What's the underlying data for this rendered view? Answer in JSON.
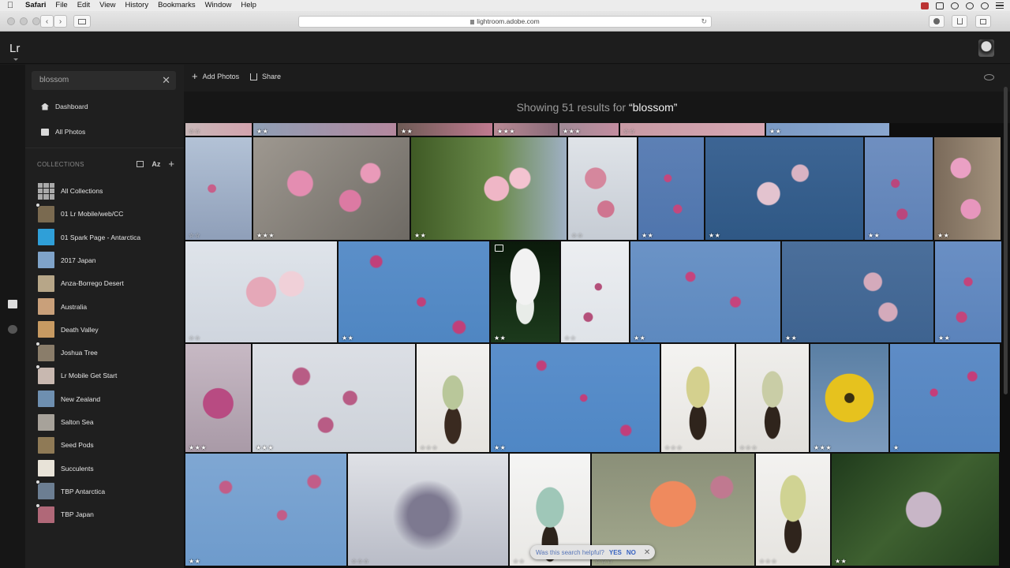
{
  "menubar": {
    "apple": "",
    "items": [
      "Safari",
      "File",
      "Edit",
      "View",
      "History",
      "Bookmarks",
      "Window",
      "Help"
    ]
  },
  "browser": {
    "url": "lightroom.adobe.com",
    "back": "‹",
    "forward": "›",
    "reload": "↻"
  },
  "app": {
    "logo": "Lr"
  },
  "sidebar": {
    "search_value": "blossom",
    "clear": "✕",
    "nav": [
      {
        "label": "Dashboard",
        "icon": "home-icon"
      },
      {
        "label": "All Photos",
        "icon": "photos-icon"
      }
    ],
    "collections_title": "COLLECTIONS",
    "sort_label": "Az",
    "add": "+",
    "collections": [
      {
        "label": "All Collections",
        "thumb": "grid"
      },
      {
        "label": "01 Lr Mobile/web/CC",
        "thumb": "#7a6a50",
        "synced": true
      },
      {
        "label": "01 Spark Page - Antarctica",
        "thumb": "#2f9fd8"
      },
      {
        "label": "2017 Japan",
        "thumb": "#7fa3c9"
      },
      {
        "label": "Anza-Borrego Desert",
        "thumb": "#b7a688"
      },
      {
        "label": "Australia",
        "thumb": "#c9a07a"
      },
      {
        "label": "Death Valley",
        "thumb": "#c79a62"
      },
      {
        "label": "Joshua Tree",
        "thumb": "#8a7d6a",
        "synced": true
      },
      {
        "label": "Lr Mobile Get Start",
        "thumb": "#c8b8b0",
        "synced": true
      },
      {
        "label": "New Zealand",
        "thumb": "#6e8fb0"
      },
      {
        "label": "Salton Sea",
        "thumb": "#a7a29a"
      },
      {
        "label": "Seed Pods",
        "thumb": "#8f7a56"
      },
      {
        "label": "Succulents",
        "thumb": "#e8e3d8"
      },
      {
        "label": "TBP Antarctica",
        "thumb": "#6c7e92",
        "synced": true
      },
      {
        "label": "TBP Japan",
        "thumb": "#b06878",
        "synced": true
      }
    ]
  },
  "toolbar": {
    "add_photos": "Add Photos",
    "share": "Share"
  },
  "results": {
    "prefix": "Showing 51 results for ",
    "query": "“blossom”"
  },
  "photos": [
    {
      "row": 0,
      "stars": "☆☆",
      "empty": true,
      "bg": "linear-gradient(90deg,#c8b7b8,#d3a3ae)"
    },
    {
      "row": 0,
      "stars": "★★",
      "empty": false,
      "bg": "linear-gradient(90deg,#8f9fb5,#b4889e)"
    },
    {
      "row": 0,
      "stars": "★★",
      "empty": false,
      "bg": "linear-gradient(90deg,#6e5b55,#c07a90)"
    },
    {
      "row": 0,
      "stars": "★★★",
      "empty": false,
      "bg": "linear-gradient(90deg,#b88a95,#8a6a78)"
    },
    {
      "row": 0,
      "stars": "★★★",
      "empty": false,
      "bg": "linear-gradient(90deg,#a08a96,#c38da0)"
    },
    {
      "row": 0,
      "stars": "☆☆",
      "empty": true,
      "bg": "linear-gradient(90deg,#c79aa4,#d7a7b3)"
    },
    {
      "row": 0,
      "stars": "★★",
      "empty": false,
      "bg": "linear-gradient(90deg,#7b9ac4,#8aa7cf)"
    },
    {
      "row": 1,
      "stars": "☆☆",
      "empty": true,
      "bg": "radial-gradient(circle at 40% 50%,#c85f8a 0 6%,transparent 7%),linear-gradient(#b3c2d6,#8f9fb9)"
    },
    {
      "row": 1,
      "stars": "★★★",
      "empty": false,
      "bg": "radial-gradient(circle at 30% 45%,#e48db1 0 10%,transparent 11%),radial-gradient(circle at 62% 62%,#dc7aa3 0 9%,transparent 10%),radial-gradient(circle at 75% 35%,#e99ab9 0 7%,transparent 8%),linear-gradient(135deg,#9e9890,#6e6a64)"
    },
    {
      "row": 1,
      "stars": "★★",
      "empty": false,
      "bg": "radial-gradient(circle at 55% 50%,#efb6c6 0 12%,transparent 13%),radial-gradient(circle at 70% 40%,#f3c3d0 0 8%,transparent 9%),linear-gradient(90deg,#3f5a25,#6a8a4a 55%,#9fb0c4)"
    },
    {
      "row": 1,
      "stars": "☆☆",
      "empty": true,
      "bg": "radial-gradient(circle at 40% 40%,#d5879d 0 14%,transparent 15%),radial-gradient(circle at 55% 70%,#cf7590 0 10%,transparent 11%),linear-gradient(#dfe3e8,#c6ccd4)"
    },
    {
      "row": 1,
      "stars": "★★",
      "empty": false,
      "bg": "radial-gradient(circle at 45% 40%,#c2487e 0 5%,transparent 6%),radial-gradient(circle at 60% 70%,#c2487e 0 5%,transparent 6%),linear-gradient(#5d80b5,#4f75ad)"
    },
    {
      "row": 1,
      "stars": "★★",
      "empty": false,
      "bg": "radial-gradient(circle at 40% 55%,#e3c3cf 0 10%,transparent 11%),radial-gradient(circle at 60% 35%,#d9b3c3 0 7%,transparent 8%),linear-gradient(#3d6594,#2f5885)"
    },
    {
      "row": 1,
      "stars": "★★",
      "empty": false,
      "bg": "radial-gradient(circle at 45% 45%,#b9477d 0 6%,transparent 7%),radial-gradient(circle at 55% 75%,#b9477d 0 6%,transparent 7%),linear-gradient(#6f8fc0,#5f82b7)"
    },
    {
      "row": 1,
      "stars": "★★",
      "empty": false,
      "bg": "radial-gradient(circle at 40% 30%,#eaa0c4 0 12%,transparent 13%),radial-gradient(circle at 55% 70%,#e796bd 0 12%,transparent 13%),linear-gradient(90deg,#7a6a5a,#a3927d)"
    },
    {
      "row": 2,
      "stars": "☆☆",
      "empty": true,
      "bg": "radial-gradient(circle at 50% 50%,#e5a8b8 0 16%,transparent 17%),radial-gradient(circle at 70% 42%,#f0d0d8 0 10%,transparent 11%),linear-gradient(#dfe4ea,#cfd5de)"
    },
    {
      "row": 2,
      "stars": "★★",
      "empty": false,
      "bg": "radial-gradient(circle at 25% 20%,#c0407a 0 4%,transparent 5%),radial-gradient(circle at 55% 60%,#c0407a 0 4%,transparent 5%),radial-gradient(circle at 80% 85%,#c0407a 0 4%,transparent 5%),linear-gradient(#5b8fc9,#4f86c2)"
    },
    {
      "row": 2,
      "stars": "★★",
      "empty": false,
      "badge": true,
      "bg": "radial-gradient(ellipse at 50% 35%,#f2f2f2 0 30%,transparent 31%),radial-gradient(ellipse at 50% 65%,#e8ece8 0 18%,transparent 19%),linear-gradient(#0b1a0b,#1c3a1c)"
    },
    {
      "row": 2,
      "stars": "☆☆",
      "empty": true,
      "bg": "radial-gradient(circle at 55% 45%,#b4507a 0 5%,transparent 6%),radial-gradient(circle at 40% 75%,#b4507a 0 5%,transparent 6%),linear-gradient(#eceef1,#dfe3e8)"
    },
    {
      "row": 2,
      "stars": "★★",
      "empty": false,
      "bg": "radial-gradient(circle at 40% 35%,#c5447d 0 4%,transparent 5%),radial-gradient(circle at 70% 60%,#c5447d 0 4%,transparent 5%),linear-gradient(#6b93c6,#5d89bf)"
    },
    {
      "row": 2,
      "stars": "★★",
      "empty": false,
      "bg": "radial-gradient(circle at 60% 40%,#d4aabb 0 8%,transparent 9%),radial-gradient(circle at 70% 70%,#d4aabb 0 7%,transparent 8%),linear-gradient(#4b6f9b,#3e6390)"
    },
    {
      "row": 2,
      "stars": "★★",
      "empty": false,
      "bg": "radial-gradient(circle at 50% 40%,#c2457c 0 6%,transparent 7%),radial-gradient(circle at 40% 75%,#c2457c 0 6%,transparent 7%),linear-gradient(#6a8fc4,#5b83bb)"
    },
    {
      "row": 3,
      "stars": "★★★",
      "empty": false,
      "bg": "radial-gradient(circle at 50% 55%,#b84b82 0 22%,transparent 23%),linear-gradient(#c7b9c4,#a99aa7)"
    },
    {
      "row": 3,
      "stars": "★★★",
      "empty": false,
      "bg": "radial-gradient(circle at 30% 30%,#b85c85 0 6%,transparent 7%),radial-gradient(circle at 60% 50%,#b85c85 0 6%,transparent 7%),radial-gradient(circle at 45% 75%,#b85c85 0 6%,transparent 7%),linear-gradient(#dcdfe5,#cdd2d9)"
    },
    {
      "row": 3,
      "stars": "☆☆☆",
      "empty": true,
      "bg": "radial-gradient(ellipse at 50% 45%,#b9c79a 0 20%,transparent 21%),radial-gradient(ellipse at 50% 75%,#3a2a20 0 16%,transparent 17%),linear-gradient(#f2f1ef,#e5e3df)"
    },
    {
      "row": 3,
      "stars": "★★",
      "empty": false,
      "bg": "radial-gradient(circle at 30% 20%,#c13f7b 0 3%,transparent 4%),radial-gradient(circle at 55% 50%,#c13f7b 0 3%,transparent 4%),radial-gradient(circle at 80% 80%,#c13f7b 0 3%,transparent 4%),linear-gradient(#5b8fcb,#4f87c5)"
    },
    {
      "row": 3,
      "stars": "☆☆☆",
      "empty": true,
      "bg": "radial-gradient(ellipse at 50% 40%,#d4d08e 0 22%,transparent 23%),radial-gradient(ellipse at 50% 72%,#2f241c 0 16%,transparent 17%),linear-gradient(#f4f3f1,#e7e5e1)"
    },
    {
      "row": 3,
      "stars": "☆☆☆",
      "empty": true,
      "bg": "radial-gradient(ellipse at 50% 42%,#c9cda6 0 20%,transparent 21%),radial-gradient(ellipse at 50% 72%,#2f241c 0 15%,transparent 16%),linear-gradient(#efeeeb,#e1dfdb)"
    },
    {
      "row": 3,
      "stars": "★★★",
      "empty": false,
      "bg": "radial-gradient(circle at 50% 50%,#3a3010 0 7%,#e6c21e 8% 36%,transparent 37%),linear-gradient(#5a7fa4,#7d9bbd)"
    },
    {
      "row": 3,
      "stars": "★",
      "empty": false,
      "bg": "radial-gradient(circle at 40% 45%,#c43e7a 0 4%,transparent 5%),radial-gradient(circle at 75% 30%,#c43e7a 0 4%,transparent 5%),linear-gradient(#5e8cc6,#5384bf)"
    },
    {
      "row": 4,
      "stars": "★★",
      "empty": false,
      "bg": "radial-gradient(circle at 25% 30%,#c25d88 0 4%,transparent 5%),radial-gradient(circle at 60% 55%,#c25d88 0 4%,transparent 5%),radial-gradient(circle at 80% 25%,#c25d88 0 4%,transparent 5%),linear-gradient(#7fa7d3,#6e9bcc)"
    },
    {
      "row": 4,
      "stars": "☆☆☆",
      "empty": true,
      "bg": "radial-gradient(circle at 50% 55%,#7d7990 0 20%,transparent 35%),linear-gradient(#dfe1e6,#b9bcc7)"
    },
    {
      "row": 4,
      "stars": "☆☆",
      "empty": true,
      "bg": "radial-gradient(ellipse at 50% 48%,#9fc7b8 0 24%,transparent 25%),radial-gradient(ellipse at 50% 80%,#2d241c 0 14%,transparent 15%),linear-gradient(#f5f5f4,#e9e8e5)"
    },
    {
      "row": 4,
      "stars": "☆☆☆",
      "empty": true,
      "bg": "radial-gradient(circle at 50% 45%,#ef8a5e 0 22%,transparent 23%),radial-gradient(circle at 80% 30%,#c07990 0 7%,transparent 8%),linear-gradient(#8a8f78,#a3a98e)"
    },
    {
      "row": 4,
      "stars": "☆☆☆",
      "empty": true,
      "bg": "radial-gradient(ellipse at 50% 40%,#d0d393 0 24%,transparent 25%),radial-gradient(ellipse at 50% 72%,#2f241c 0 16%,transparent 17%),linear-gradient(#f3f2f0,#e6e4e0)"
    },
    {
      "row": 4,
      "stars": "★★",
      "empty": false,
      "bg": "radial-gradient(circle at 55% 50%,#c8b6c7 0 16%,transparent 17%),linear-gradient(135deg,#1f3a1c,#3e6030 50%,#24401f)"
    }
  ],
  "toast": {
    "question": "Was this search helpful?",
    "yes": "YES",
    "no": "NO",
    "close": "✕"
  }
}
